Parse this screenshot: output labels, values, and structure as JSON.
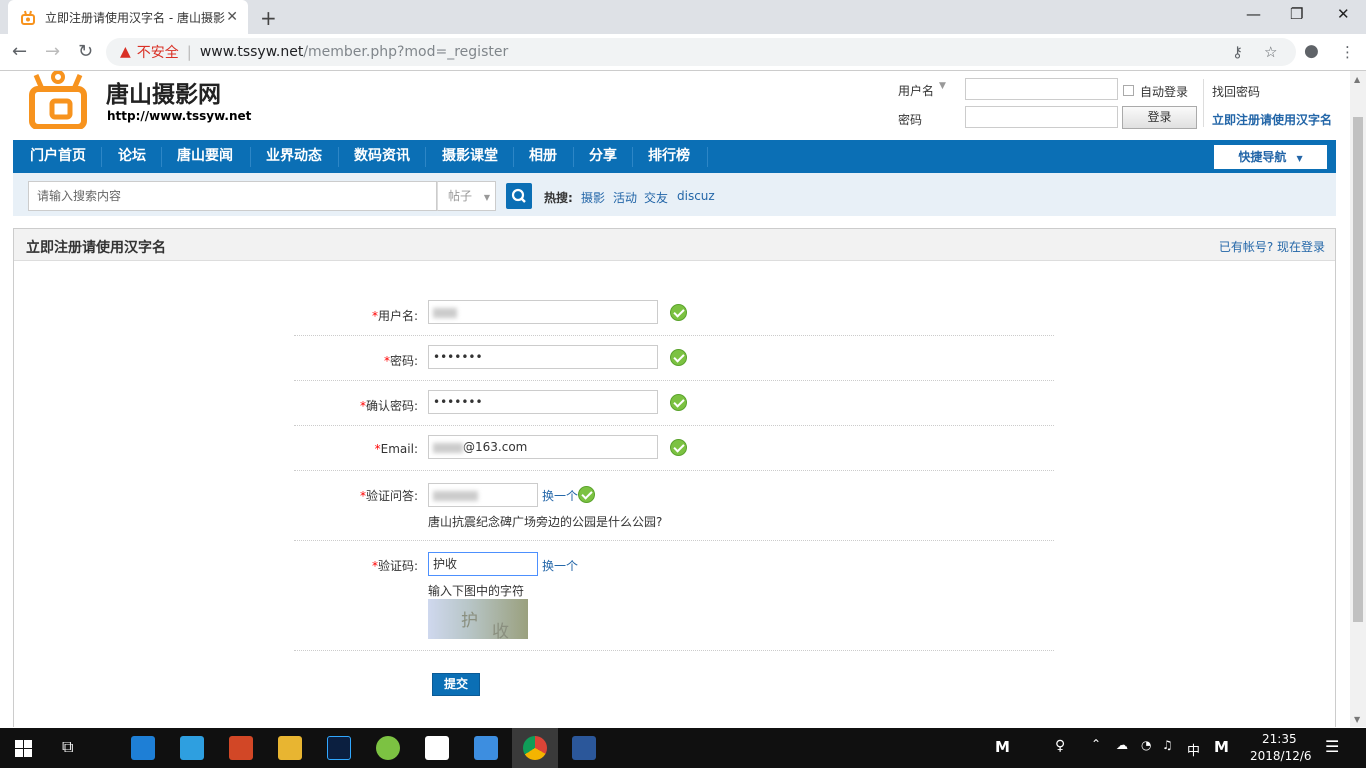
{
  "browser": {
    "tab_title": "立即注册请使用汉字名 - 唐山摄影",
    "close_tab": "✕",
    "new_tab": "+",
    "insecure": "不安全",
    "url_host": "www.tssyw.net",
    "url_path": "/member.php?mod=_register",
    "minimize": "—",
    "maximize": "❐",
    "close": "✕"
  },
  "site": {
    "name": "唐山摄影网",
    "url": "http://www.tssyw.net"
  },
  "login": {
    "username_label": "用户名",
    "password_label": "密码",
    "auto_login": "自动登录",
    "login_button": "登录",
    "find_password": "找回密码",
    "register_link": "立即注册请使用汉字名"
  },
  "nav": {
    "items": [
      "门户首页",
      "论坛",
      "唐山要闻",
      "业界动态",
      "数码资讯",
      "摄影课堂",
      "相册",
      "分享",
      "排行榜"
    ],
    "quick_nav": "快捷导航"
  },
  "search": {
    "placeholder": "请输入搜索内容",
    "type": "帖子",
    "hot_label": "热搜:",
    "hot": [
      "摄影",
      "活动",
      "交友",
      "discuz"
    ]
  },
  "form": {
    "title": "立即注册请使用汉字名",
    "login_link": "已有帐号? 现在登录",
    "username_label": "用户名:",
    "password_label": "密码:",
    "password_value": "•••••••",
    "confirm_label": "确认密码:",
    "confirm_value": "•••••••",
    "email_label": "Email:",
    "email_value": "@163.com",
    "question_label": "验证问答:",
    "question_change": "换一个",
    "question_text": "唐山抗震纪念碑广场旁边的公园是什么公园?",
    "captcha_label": "验证码:",
    "captcha_value": "护收",
    "captcha_change": "换一个",
    "captcha_hint": "输入下图中的字符",
    "captcha_chars": [
      "护",
      "收"
    ],
    "submit": "提交"
  },
  "taskbar": {
    "ime_mode": "M",
    "lang": "中",
    "ime": "M",
    "time": "21:35",
    "date": "2018/12/6"
  }
}
